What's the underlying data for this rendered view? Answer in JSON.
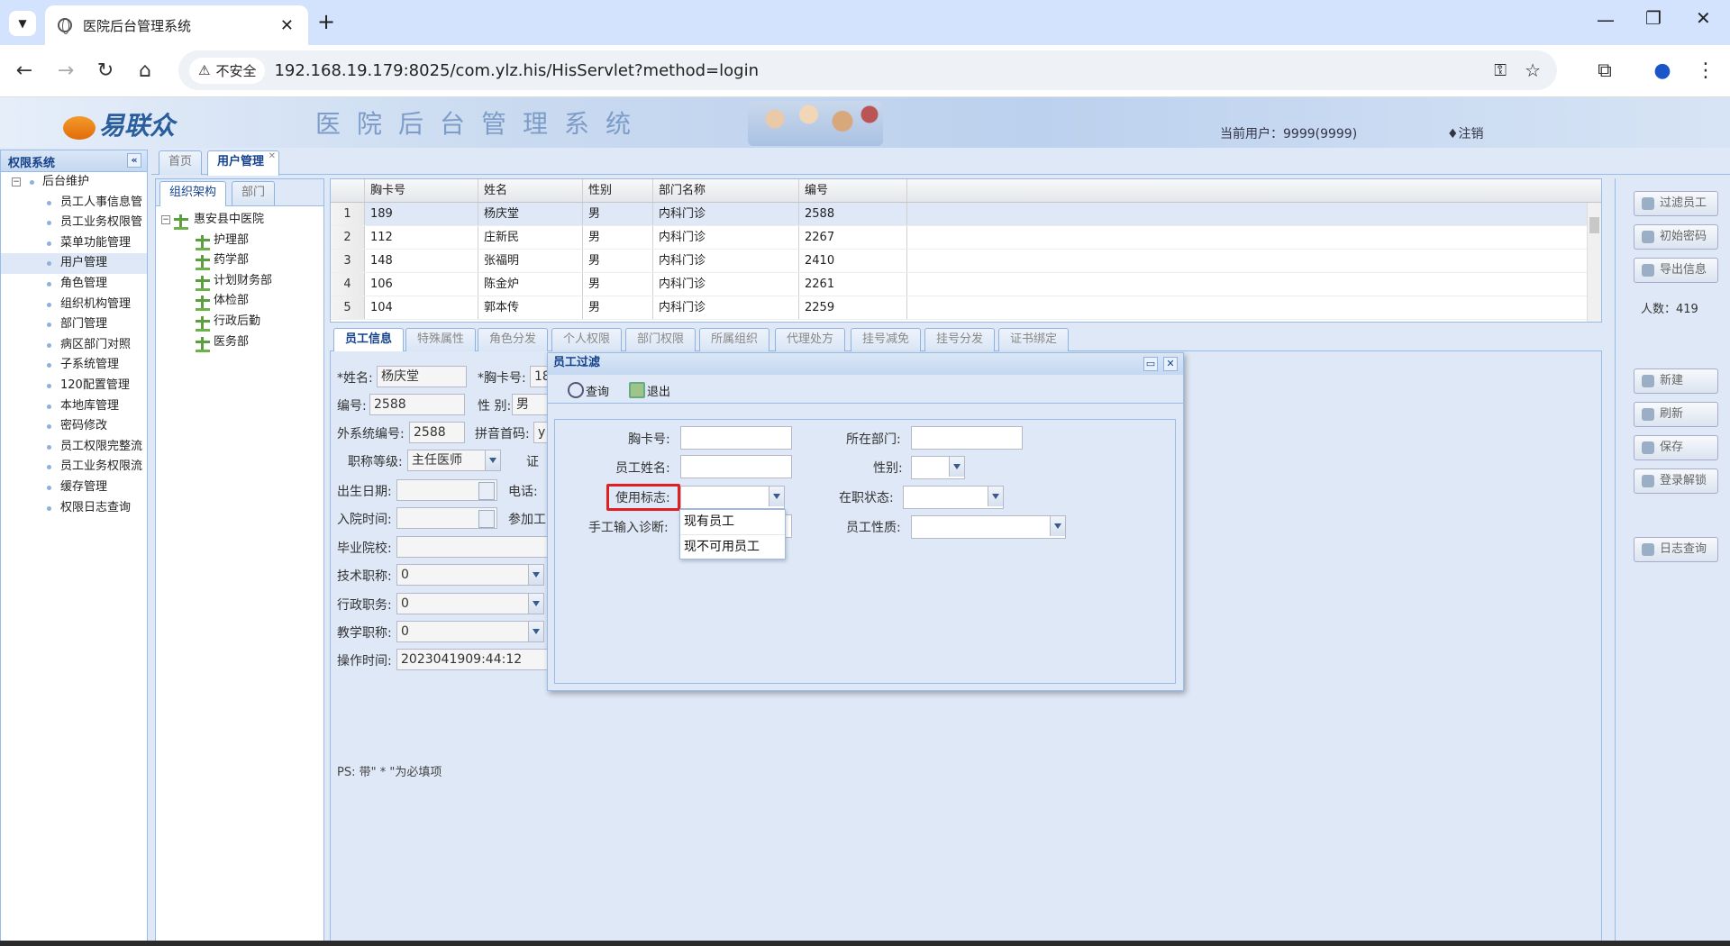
{
  "browser": {
    "tab_title": "医院后台管理系统",
    "security_label": "不安全",
    "url": "192.168.19.179:8025/com.ylz.his/HisServlet?method=login"
  },
  "banner": {
    "logo_text": "易联众",
    "system_title": "医院后台管理系统",
    "current_user": "当前用户：9999(9999)",
    "logout": "♦注销"
  },
  "left_panel": {
    "title": "权限系统",
    "root": "后台维护",
    "items": [
      "员工人事信息管",
      "员工业务权限管",
      "菜单功能管理",
      "用户管理",
      "角色管理",
      "组织机构管理",
      "部门管理",
      "病区部门对照",
      "子系统管理",
      "120配置管理",
      "本地库管理",
      "密码修改",
      "员工权限完整流",
      "员工业务权限流",
      "缓存管理",
      "权限日志查询"
    ],
    "selected": "用户管理"
  },
  "main_tabs": [
    "首页",
    "用户管理"
  ],
  "org_panel": {
    "tabs": [
      "组织架构",
      "部门"
    ],
    "root": "惠安县中医院",
    "departments": [
      "护理部",
      "药学部",
      "计划财务部",
      "体检部",
      "行政后勤",
      "医务部"
    ]
  },
  "grid": {
    "headers": [
      "胸卡号",
      "姓名",
      "性别",
      "部门名称",
      "编号"
    ],
    "rows": [
      {
        "n": "1",
        "card": "189",
        "name": "杨庆堂",
        "sex": "男",
        "dept": "内科门诊",
        "code": "2588"
      },
      {
        "n": "2",
        "card": "112",
        "name": "庄新民",
        "sex": "男",
        "dept": "内科门诊",
        "code": "2267"
      },
      {
        "n": "3",
        "card": "148",
        "name": "张福明",
        "sex": "男",
        "dept": "内科门诊",
        "code": "2410"
      },
      {
        "n": "4",
        "card": "106",
        "name": "陈金炉",
        "sex": "男",
        "dept": "内科门诊",
        "code": "2261"
      },
      {
        "n": "5",
        "card": "104",
        "name": "郭本传",
        "sex": "男",
        "dept": "内科门诊",
        "code": "2259"
      }
    ]
  },
  "right_buttons": {
    "filter": "过滤员工",
    "init_pwd": "初始密码",
    "export": "导出信息",
    "count": "人数：419",
    "new": "新建",
    "refresh": "刷新",
    "save": "保存",
    "unlock": "登录解锁",
    "log": "日志查询"
  },
  "detail_tabs": [
    "员工信息",
    "特殊属性",
    "角色分发",
    "个人权限",
    "部门权限",
    "所属组织",
    "代理处方",
    "挂号减免",
    "挂号分发",
    "证书绑定"
  ],
  "form": {
    "name_label": "*姓名:",
    "name_value": "杨庆堂",
    "card_label": "*胸卡号:",
    "card_value": "18",
    "code_label": "编号:",
    "code_value": "2588",
    "sex_label": "性 别:",
    "sex_value": "男",
    "ext_code_label": "外系统编号:",
    "ext_code_value": "2588",
    "pinyin_label": "拼音首码:",
    "pinyin_value": "y",
    "title_level_label": "职称等级:",
    "title_level_value": "主任医师",
    "cert_label": "证",
    "birth_label": "出生日期:",
    "phone_label": "电话:",
    "join_label": "入院时间:",
    "work_label": "参加工",
    "school_label": "毕业院校:",
    "tech_label": "技术职称:",
    "tech_value": "0",
    "admin_label": "行政职务:",
    "admin_value": "0",
    "teach_label": "教学职称:",
    "teach_value": "0",
    "optime_label": "操作时间:",
    "optime_value": "2023041909:44:12",
    "ps": "PS: 带\" * \"为必填项"
  },
  "dialog": {
    "title": "员工过滤",
    "query": "查询",
    "exit": "退出",
    "card_label": "胸卡号:",
    "dept_label": "所在部门:",
    "name_label": "员工姓名:",
    "sex_label": "性别:",
    "use_flag_label": "使用标志:",
    "status_label": "在职状态:",
    "diag_label": "手工输入诊断:",
    "nature_label": "员工性质:",
    "use_flag_options": [
      "现有员工",
      "现不可用员工"
    ]
  }
}
